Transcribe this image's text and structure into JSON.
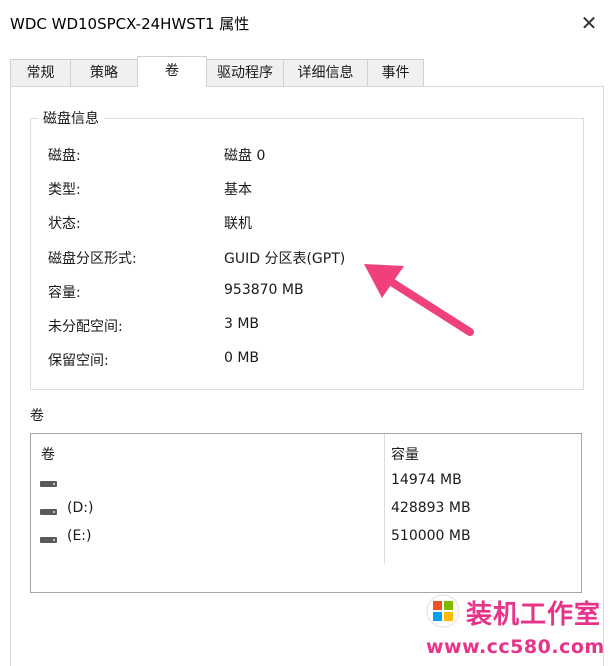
{
  "window": {
    "title": "WDC WD10SPCX-24HWST1 属性",
    "close_symbol": "✕"
  },
  "tabs": [
    {
      "label": "常规",
      "active": false
    },
    {
      "label": "策略",
      "active": false
    },
    {
      "label": "卷",
      "active": true
    },
    {
      "label": "驱动程序",
      "active": false
    },
    {
      "label": "详细信息",
      "active": false
    },
    {
      "label": "事件",
      "active": false
    }
  ],
  "disk_info": {
    "group_title": "磁盘信息",
    "rows": [
      {
        "label": "磁盘:",
        "value": "磁盘 0"
      },
      {
        "label": "类型:",
        "value": "基本"
      },
      {
        "label": "状态:",
        "value": "联机"
      },
      {
        "label": "磁盘分区形式:",
        "value": "GUID 分区表(GPT)"
      },
      {
        "label": "容量:",
        "value": "953870 MB"
      },
      {
        "label": "未分配空间:",
        "value": "3 MB"
      },
      {
        "label": "保留空间:",
        "value": "0 MB"
      }
    ]
  },
  "volumes": {
    "section_title": "卷",
    "columns": [
      "卷",
      "容量"
    ],
    "rows": [
      {
        "volume": "",
        "capacity": "14974 MB",
        "icon": "drive-icon"
      },
      {
        "volume": "(D:)",
        "capacity": "428893 MB",
        "icon": "drive-icon"
      },
      {
        "volume": "(E:)",
        "capacity": "510000 MB",
        "icon": "drive-icon"
      }
    ]
  },
  "annotation": {
    "icon": "pink-arrow-icon",
    "color": "#f0407a"
  },
  "watermark": {
    "brand": "装机工作室",
    "url": "www.cc580.com",
    "color": "#e8338a",
    "logo_icon": "windows-logo-icon"
  }
}
